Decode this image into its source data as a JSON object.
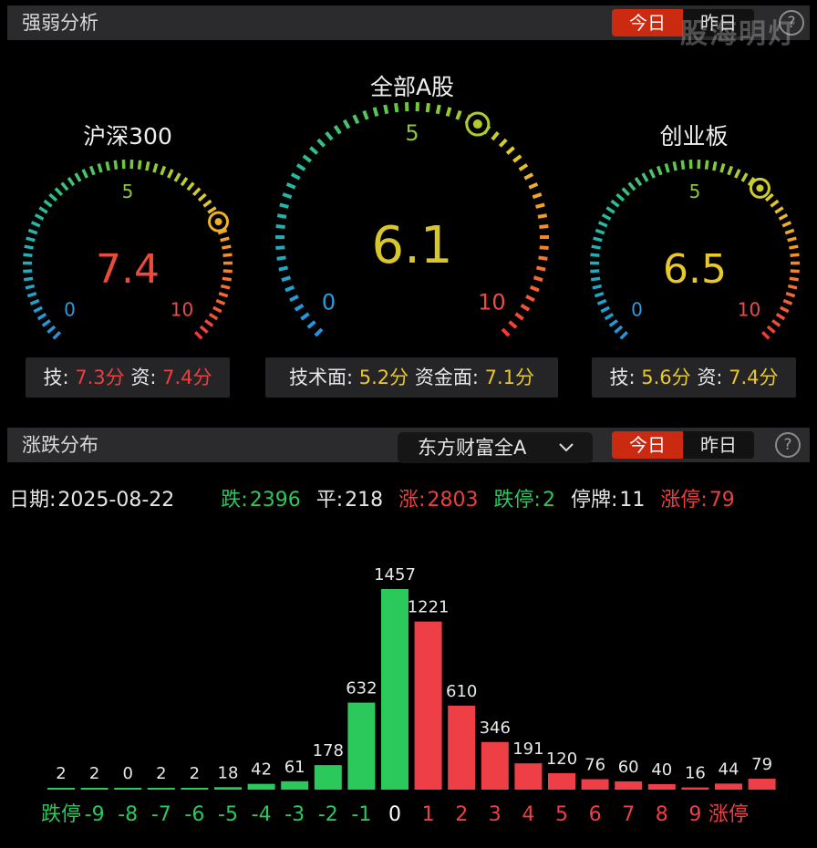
{
  "panel1": {
    "title": "强弱分析",
    "today": "今日",
    "yesterday": "昨日",
    "help": "?"
  },
  "watermark": "股海明灯",
  "gauges": [
    {
      "title": "沪深300",
      "value": 7.4,
      "value_text": "7.4",
      "min_label": "0",
      "mid_label": "5",
      "max_label": "10",
      "tech_label": "技:",
      "tech_value": "7.3分",
      "fund_label": "资:",
      "fund_value": "7.4分",
      "value_color": "#ee4a3a"
    },
    {
      "title": "全部A股",
      "value": 6.1,
      "value_text": "6.1",
      "min_label": "0",
      "mid_label": "5",
      "max_label": "10",
      "tech_label": "技术面:",
      "tech_value": "5.2分",
      "fund_label": "资金面:",
      "fund_value": "7.1分",
      "value_color": "#d8c72c"
    },
    {
      "title": "创业板",
      "value": 6.5,
      "value_text": "6.5",
      "min_label": "0",
      "mid_label": "5",
      "max_label": "10",
      "tech_label": "技:",
      "tech_value": "5.6分",
      "fund_label": "资:",
      "fund_value": "7.4分",
      "value_color": "#e8c92a"
    }
  ],
  "panel2": {
    "title": "涨跌分布",
    "market": "东方财富全A",
    "today": "今日",
    "yesterday": "昨日",
    "help": "?"
  },
  "stats": {
    "date_label": "日期:",
    "date": "2025-08-22",
    "down_label": "跌:",
    "down": "2396",
    "flat_label": "平:",
    "flat": "218",
    "up_label": "涨:",
    "up": "2803",
    "limit_down_label": "跌停:",
    "limit_down": "2",
    "suspended_label": "停牌:",
    "suspended": "11",
    "limit_up_label": "涨停:",
    "limit_up": "79"
  },
  "chart_data": {
    "type": "bar",
    "categories": [
      "跌停",
      "-9",
      "-8",
      "-7",
      "-6",
      "-5",
      "-4",
      "-3",
      "-2",
      "-1",
      "0",
      "1",
      "2",
      "3",
      "4",
      "5",
      "6",
      "7",
      "8",
      "9",
      "涨停"
    ],
    "values": [
      2,
      2,
      0,
      2,
      2,
      18,
      42,
      61,
      178,
      632,
      1457,
      1221,
      610,
      346,
      191,
      120,
      76,
      60,
      40,
      16,
      44,
      79
    ],
    "colors": {
      "down": "#2bc85c",
      "up": "#ee3f47",
      "zero": "#ffffff"
    }
  }
}
